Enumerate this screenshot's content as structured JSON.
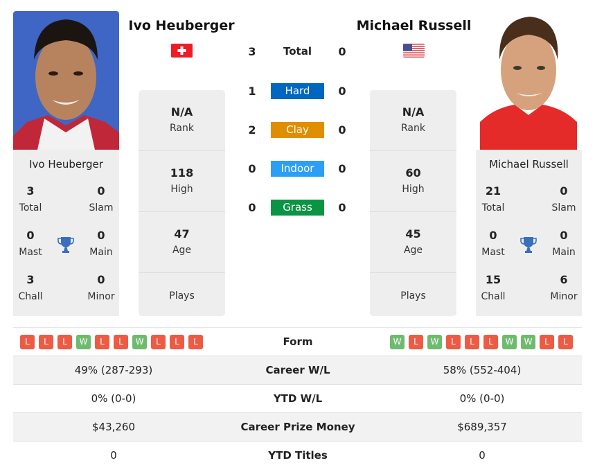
{
  "colors": {
    "hard": "#0066c0",
    "clay": "#e08e00",
    "indoor": "#2b9ff5",
    "grass": "#0b9444",
    "win": "#6fba6f",
    "loss": "#ee5b45",
    "trophy": "#3a6fbf"
  },
  "player1": {
    "name": "Ivo Heuberger",
    "flag": "switzerland-flag",
    "photo": "player-photo",
    "titles": {
      "name": "Ivo Heuberger",
      "total": {
        "value": "3",
        "label": "Total"
      },
      "slam": {
        "value": "0",
        "label": "Slam"
      },
      "mast": {
        "value": "0",
        "label": "Mast"
      },
      "main": {
        "value": "0",
        "label": "Main"
      },
      "chall": {
        "value": "3",
        "label": "Chall"
      },
      "minor": {
        "value": "0",
        "label": "Minor"
      }
    },
    "info": {
      "rank": {
        "value": "N/A",
        "label": "Rank"
      },
      "high": {
        "value": "118",
        "label": "High"
      },
      "age": {
        "value": "47",
        "label": "Age"
      },
      "plays": {
        "label": "Plays"
      }
    },
    "form": [
      "L",
      "L",
      "L",
      "W",
      "L",
      "L",
      "W",
      "L",
      "L",
      "L"
    ],
    "career_wl": "49% (287-293)",
    "ytd_wl": "0% (0-0)",
    "career_prize": "$43,260",
    "ytd_titles": "0"
  },
  "player2": {
    "name": "Michael Russell",
    "flag": "usa-flag",
    "photo": "player-photo",
    "titles": {
      "name": "Michael Russell",
      "total": {
        "value": "21",
        "label": "Total"
      },
      "slam": {
        "value": "0",
        "label": "Slam"
      },
      "mast": {
        "value": "0",
        "label": "Mast"
      },
      "main": {
        "value": "0",
        "label": "Main"
      },
      "chall": {
        "value": "15",
        "label": "Chall"
      },
      "minor": {
        "value": "6",
        "label": "Minor"
      }
    },
    "info": {
      "rank": {
        "value": "N/A",
        "label": "Rank"
      },
      "high": {
        "value": "60",
        "label": "High"
      },
      "age": {
        "value": "45",
        "label": "Age"
      },
      "plays": {
        "label": "Plays"
      }
    },
    "form": [
      "W",
      "L",
      "W",
      "L",
      "L",
      "L",
      "W",
      "W",
      "L",
      "L"
    ],
    "career_wl": "58% (552-404)",
    "ytd_wl": "0% (0-0)",
    "career_prize": "$689,357",
    "ytd_titles": "0"
  },
  "h2h": {
    "total": {
      "label": "Total",
      "p1": "3",
      "p2": "0"
    },
    "hard": {
      "label": "Hard",
      "p1": "1",
      "p2": "0"
    },
    "clay": {
      "label": "Clay",
      "p1": "2",
      "p2": "0"
    },
    "indoor": {
      "label": "Indoor",
      "p1": "0",
      "p2": "0"
    },
    "grass": {
      "label": "Grass",
      "p1": "0",
      "p2": "0"
    }
  },
  "table": {
    "form_label": "Form",
    "career_wl_label": "Career W/L",
    "ytd_wl_label": "YTD W/L",
    "career_prize_label": "Career Prize Money",
    "ytd_titles_label": "YTD Titles"
  }
}
